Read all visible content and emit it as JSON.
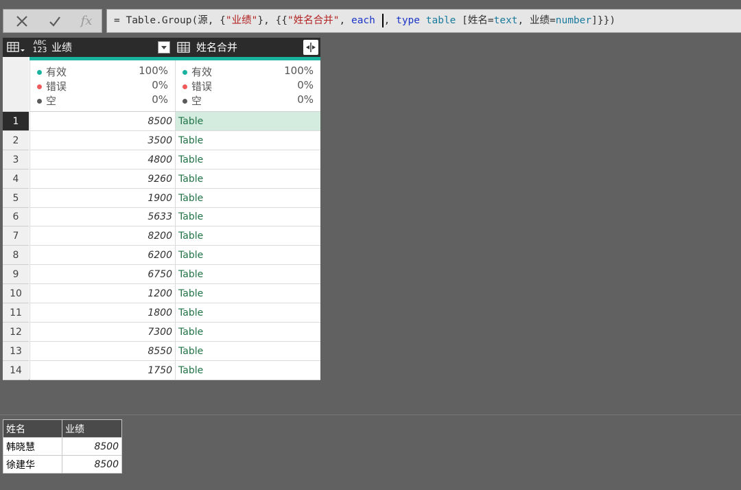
{
  "formula_bar": {
    "cancel_icon": "close-icon",
    "confirm_icon": "check-icon",
    "fx_label": "fx",
    "parts": {
      "p1": "= Table.Group(源, {",
      "p2": "\"业绩\"",
      "p3": "}, {{",
      "p4": "\"姓名合并\"",
      "p5": ", ",
      "p6": "each",
      "p7": " ",
      "p8": ", ",
      "p9": "type",
      "p10": " ",
      "p11": "table",
      "p12": " [姓名=",
      "p13": "text",
      "p14": ", 业绩=",
      "p15": "number",
      "p16": "]}})"
    }
  },
  "grid": {
    "corner_icon": "table-menu-icon",
    "col1": {
      "type_icon": "abc123-type-icon",
      "type_top": "ABC",
      "type_bottom": "123",
      "title": "业绩",
      "filter_icon": "dropdown-filter-icon"
    },
    "col2": {
      "type_icon": "table-type-icon",
      "title": "姓名合并",
      "expand_icon": "expand-columns-icon"
    },
    "stats_labels": {
      "valid": "有效",
      "error": "错误",
      "empty": "空"
    },
    "col1_stats": {
      "valid": "100%",
      "error": "0%",
      "empty": "0%"
    },
    "col2_stats": {
      "valid": "100%",
      "error": "0%",
      "empty": "0%"
    },
    "rows": [
      {
        "n": "1",
        "v": "8500",
        "t": "Table"
      },
      {
        "n": "2",
        "v": "3500",
        "t": "Table"
      },
      {
        "n": "3",
        "v": "4800",
        "t": "Table"
      },
      {
        "n": "4",
        "v": "9260",
        "t": "Table"
      },
      {
        "n": "5",
        "v": "1900",
        "t": "Table"
      },
      {
        "n": "6",
        "v": "5633",
        "t": "Table"
      },
      {
        "n": "7",
        "v": "8200",
        "t": "Table"
      },
      {
        "n": "8",
        "v": "6200",
        "t": "Table"
      },
      {
        "n": "9",
        "v": "6750",
        "t": "Table"
      },
      {
        "n": "10",
        "v": "1200",
        "t": "Table"
      },
      {
        "n": "11",
        "v": "1800",
        "t": "Table"
      },
      {
        "n": "12",
        "v": "7300",
        "t": "Table"
      },
      {
        "n": "13",
        "v": "8550",
        "t": "Table"
      },
      {
        "n": "14",
        "v": "1750",
        "t": "Table"
      }
    ]
  },
  "detail_table": {
    "headers": [
      "姓名",
      "业绩"
    ],
    "rows": [
      [
        "韩晓慧",
        "8500"
      ],
      [
        "徐建华",
        "8500"
      ]
    ]
  },
  "colors": {
    "valid": "#19b3a0",
    "error": "#f05a5a",
    "empty": "#5a5a5a",
    "teal_bar": "#19b3a0",
    "table_link": "#217346"
  }
}
